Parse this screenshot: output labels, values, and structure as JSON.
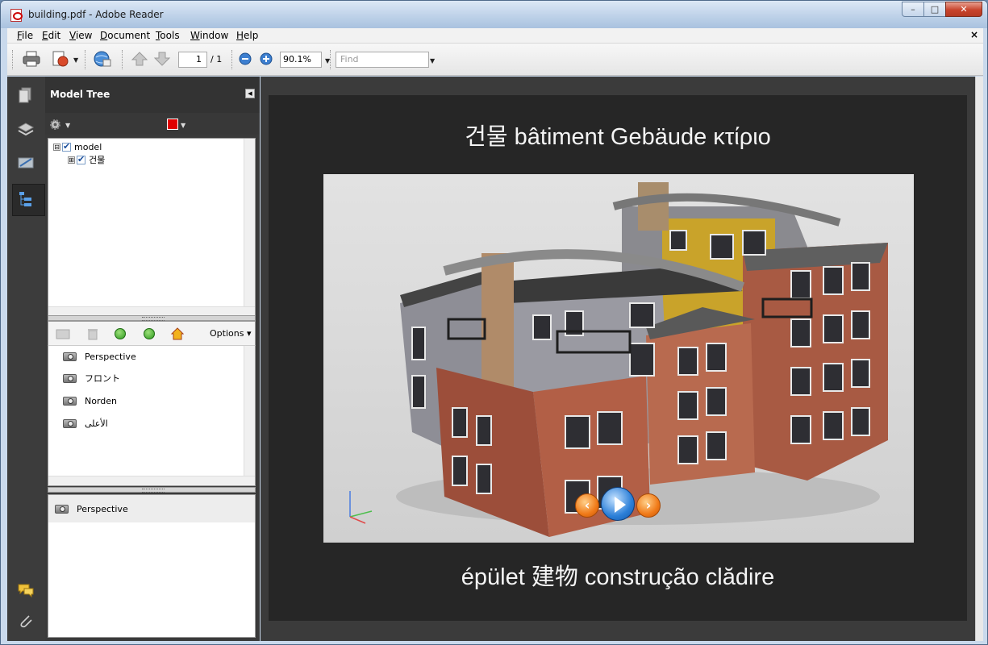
{
  "window": {
    "title": "building.pdf - Adobe Reader",
    "controls": {
      "minimize": "–",
      "maximize": "□",
      "close": "✕"
    }
  },
  "menu": {
    "items": [
      "File",
      "Edit",
      "View",
      "Document",
      "Tools",
      "Window",
      "Help"
    ],
    "doc_close": "×"
  },
  "toolbar": {
    "page_current": "1",
    "page_total": "/ 1",
    "zoom": "90.1%",
    "find_placeholder": "Find"
  },
  "model_tree": {
    "title": "Model Tree",
    "swatch_color": "#e00000",
    "nodes": [
      {
        "label": "model",
        "expander": "⊟"
      },
      {
        "label": "건물",
        "expander": "⊞"
      }
    ],
    "options_label": "Options ▾",
    "views": [
      "Perspective",
      "フロント",
      "Norden",
      "الأعلى"
    ],
    "properties": {
      "selected_view": "Perspective"
    }
  },
  "document": {
    "title_top": "건물 bâtiment Gebäude κτίριο",
    "title_bottom": "épület 建物 construção clădire",
    "prev_glyph": "‹",
    "next_glyph": "›"
  }
}
